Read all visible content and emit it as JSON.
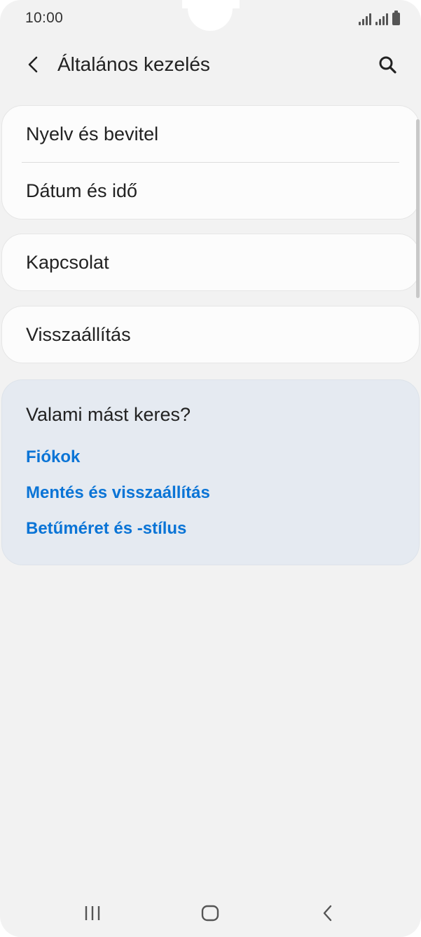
{
  "status_bar": {
    "time": "10:00"
  },
  "header": {
    "title": "Általános kezelés",
    "back_icon": "chevron-left-icon",
    "search_icon": "search-icon"
  },
  "groups": [
    {
      "items": [
        "Nyelv és bevitel",
        "Dátum és idő"
      ]
    },
    {
      "items": [
        "Kapcsolat"
      ]
    },
    {
      "items": [
        "Visszaállítás"
      ]
    }
  ],
  "suggestions": {
    "title": "Valami mást keres?",
    "links": [
      "Fiókok",
      "Mentés és visszaállítás",
      "Betűméret és -stílus"
    ]
  },
  "colors": {
    "background": "#f2f2f2",
    "card": "#fcfcfc",
    "suggestion_card": "#e5eaf1",
    "link": "#0a74d6"
  },
  "nav_bar": {
    "recents_icon": "recents-icon",
    "home_icon": "home-icon",
    "back_icon": "back-icon"
  }
}
